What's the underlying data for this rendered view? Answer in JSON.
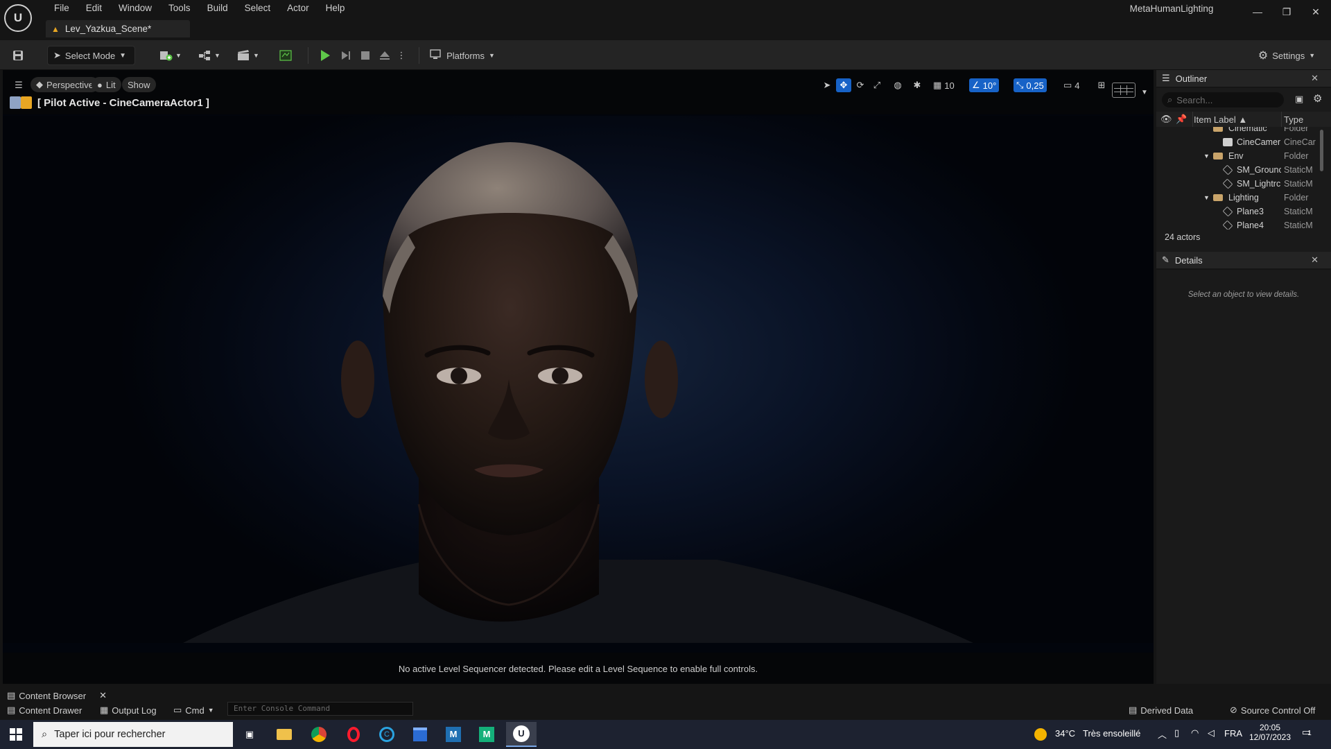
{
  "app": {
    "project_name": "MetaHumanLighting",
    "level_tab": "Lev_Yazkua_Scene*",
    "logo_text": "U"
  },
  "menu": [
    "File",
    "Edit",
    "Window",
    "Tools",
    "Build",
    "Select",
    "Actor",
    "Help"
  ],
  "toolbar": {
    "select_mode_label": "Select Mode",
    "platforms_label": "Platforms",
    "settings_label": "Settings"
  },
  "viewport": {
    "perspective_label": "Perspective",
    "lit_label": "Lit",
    "show_label": "Show",
    "grid_snap": "10",
    "angle_snap": "10°",
    "scale_snap": "0,25",
    "camera_speed": "4",
    "pilot_text": "[ Pilot Active - CineCameraActor1 ]",
    "sequencer_message": "No active Level Sequencer detected. Please edit a Level Sequence to enable full controls."
  },
  "outliner": {
    "title": "Outliner",
    "search_placeholder": "Search...",
    "col_item_label": "Item Label",
    "col_type": "Type",
    "rows": [
      {
        "label": "Cinematic",
        "type": "Folder",
        "kind": "folder",
        "depth": 1
      },
      {
        "label": "CineCamer",
        "type": "CineCar",
        "kind": "cam",
        "depth": 2
      },
      {
        "label": "Env",
        "type": "Folder",
        "kind": "folder",
        "depth": 1
      },
      {
        "label": "SM_Grounc",
        "type": "StaticM",
        "kind": "mesh",
        "depth": 2
      },
      {
        "label": "SM_Lightrc",
        "type": "StaticM",
        "kind": "mesh",
        "depth": 2
      },
      {
        "label": "Lighting",
        "type": "Folder",
        "kind": "folder",
        "depth": 1
      },
      {
        "label": "Plane3",
        "type": "StaticM",
        "kind": "mesh",
        "depth": 2
      },
      {
        "label": "Plane4",
        "type": "StaticM",
        "kind": "mesh",
        "depth": 2
      }
    ],
    "actor_count": "24 actors"
  },
  "details": {
    "title": "Details",
    "empty_message": "Select an object to view details."
  },
  "bottom": {
    "content_browser_tab": "Content Browser",
    "content_drawer": "Content Drawer",
    "output_log": "Output Log",
    "cmd_label": "Cmd",
    "console_placeholder": "Enter Console Command",
    "derived_data": "Derived Data",
    "source_control": "Source Control Off"
  },
  "taskbar": {
    "search_placeholder": "Taper ici pour rechercher",
    "weather_temp": "34°C",
    "weather_desc": "Très ensoleillé",
    "language": "FRA",
    "time": "20:05",
    "date": "12/07/2023",
    "notification_count": "1"
  },
  "colors": {
    "accent_blue": "#1762c7",
    "play_green": "#5fc84a",
    "folder": "#c9a46a",
    "warning_orange": "#e8a623"
  }
}
